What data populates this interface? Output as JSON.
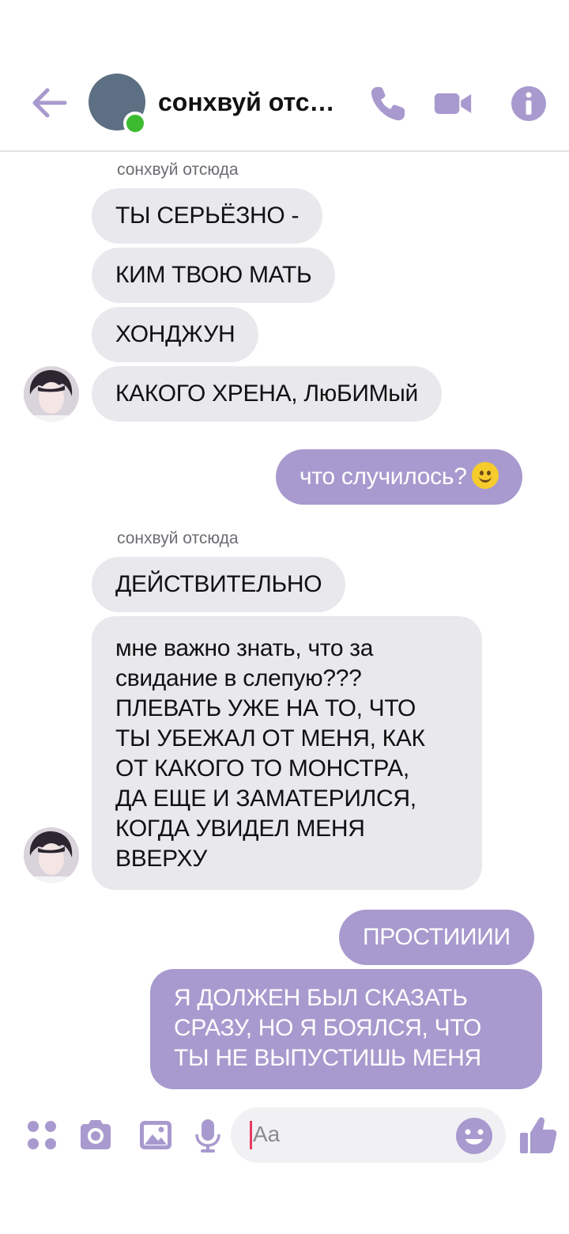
{
  "header": {
    "contact_name": "сонхвуй отсюда",
    "online": true,
    "icons": [
      "back-arrow-icon",
      "phone-icon",
      "video-camera-icon",
      "info-icon"
    ]
  },
  "colors": {
    "accent": "#a89ace",
    "incoming_bubble": "#e9e8ec",
    "online": "#3dbb30"
  },
  "messages": {
    "group1": {
      "sender": "сонхвуй отсюда",
      "m1": "ТЫ СЕРЬЁЗНО -",
      "m2": "КИМ ТВОЮ МАТЬ",
      "m3": "ХОНДЖУН",
      "m4": "КАКОГО ХРЕНА, ЛюБИМый"
    },
    "out1": "что случилось?",
    "group2": {
      "sender": "сонхвуй отсюда",
      "m1": "ДЕЙСТВИТЕЛЬНО",
      "m2_lines": [
        "мне важно знать, что за",
        "свидание в слепую???",
        "ПЛЕВАТЬ УЖЕ НА ТО, ЧТО",
        "ТЫ УБЕЖАЛ ОТ МЕНЯ, КАК",
        "ОТ КАКОГО ТО МОНСТРА,",
        "ДА ЕЩЕ И ЗАМАТЕРИЛСЯ,",
        "КОГДА УВИДЕЛ МЕНЯ",
        "ВВЕРХУ"
      ]
    },
    "out2": "ПРОСТИИИИ",
    "out3_lines": [
      "Я ДОЛЖЕН БЫЛ СКАЗАТЬ",
      "СРАЗУ, НО Я БОЯЛСЯ, ЧТО",
      "ТЫ НЕ ВЫПУСТИШЬ МЕНЯ"
    ]
  },
  "composer": {
    "placeholder": "Aa",
    "icons": [
      "apps-grid-icon",
      "camera-icon",
      "gallery-icon",
      "microphone-icon",
      "emoji-icon",
      "thumbs-up-icon"
    ]
  }
}
